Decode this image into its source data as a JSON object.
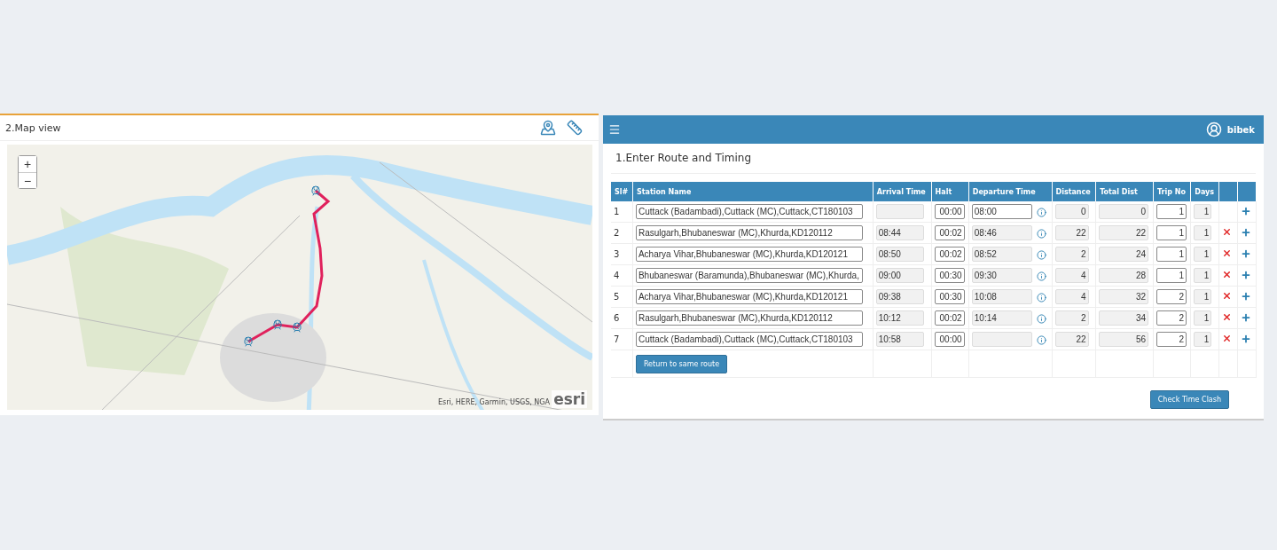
{
  "map_panel": {
    "title": "2.Map view",
    "zoom_in": "+",
    "zoom_out": "−",
    "attribution": "Esri, HERE, Garmin, USGS, NGA",
    "logo": "esri"
  },
  "route_panel": {
    "user": "bibek",
    "title": "1.Enter Route and Timing",
    "columns": [
      "Sl#",
      "Station Name",
      "Arrival Time",
      "Halt",
      "Departure Time",
      "Distance",
      "Total Dist",
      "Trip No",
      "Days"
    ],
    "rows": [
      {
        "sl": "1",
        "station": "Cuttack (Badambadi),Cuttack (MC),Cuttack,CT180103",
        "arrival": "",
        "halt": "00:00",
        "departure": "08:00",
        "departure_editable": true,
        "distance": "0",
        "total": "0",
        "trip": "1",
        "days": "1",
        "removable": false
      },
      {
        "sl": "2",
        "station": "Rasulgarh,Bhubaneswar (MC),Khurda,KD120112",
        "arrival": "08:44",
        "halt": "00:02",
        "departure": "08:46",
        "departure_editable": false,
        "distance": "22",
        "total": "22",
        "trip": "1",
        "days": "1",
        "removable": true
      },
      {
        "sl": "3",
        "station": "Acharya Vihar,Bhubaneswar (MC),Khurda,KD120121",
        "arrival": "08:50",
        "halt": "00:02",
        "departure": "08:52",
        "departure_editable": false,
        "distance": "2",
        "total": "24",
        "trip": "1",
        "days": "1",
        "removable": true
      },
      {
        "sl": "4",
        "station": "Bhubaneswar (Baramunda),Bhubaneswar (MC),Khurda,",
        "arrival": "09:00",
        "halt": "00:30",
        "departure": "09:30",
        "departure_editable": false,
        "distance": "4",
        "total": "28",
        "trip": "1",
        "days": "1",
        "removable": true
      },
      {
        "sl": "5",
        "station": "Acharya Vihar,Bhubaneswar (MC),Khurda,KD120121",
        "arrival": "09:38",
        "halt": "00:30",
        "departure": "10:08",
        "departure_editable": false,
        "distance": "4",
        "total": "32",
        "trip": "2",
        "days": "1",
        "removable": true
      },
      {
        "sl": "6",
        "station": "Rasulgarh,Bhubaneswar (MC),Khurda,KD120112",
        "arrival": "10:12",
        "halt": "00:02",
        "departure": "10:14",
        "departure_editable": false,
        "distance": "2",
        "total": "34",
        "trip": "2",
        "days": "1",
        "removable": true
      },
      {
        "sl": "7",
        "station": "Cuttack (Badambadi),Cuttack (MC),Cuttack,CT180103",
        "arrival": "10:58",
        "halt": "00:00",
        "departure": "",
        "departure_editable": false,
        "distance": "22",
        "total": "56",
        "trip": "2",
        "days": "1",
        "removable": true
      }
    ],
    "return_button": "Return to same route",
    "check_button": "Check Time Clash"
  }
}
